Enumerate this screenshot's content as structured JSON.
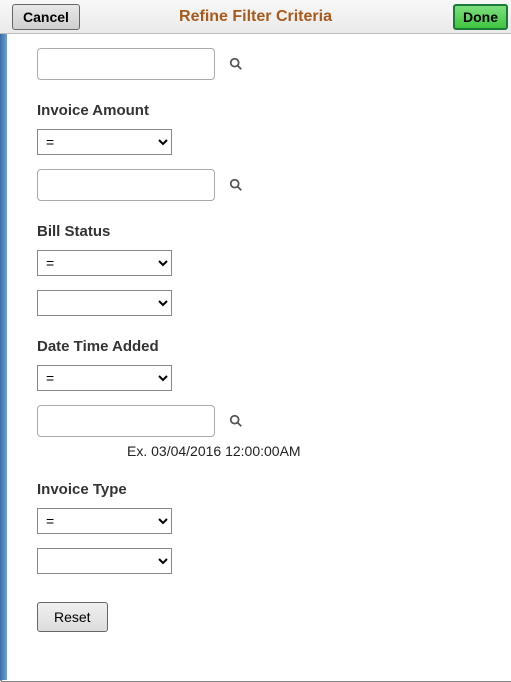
{
  "header": {
    "title": "Refine Filter Criteria",
    "cancel_label": "Cancel",
    "done_label": "Done"
  },
  "fields": {
    "top_lookup": {
      "value": ""
    },
    "invoice_amount": {
      "label": "Invoice Amount",
      "operator": "=",
      "value": ""
    },
    "bill_status": {
      "label": "Bill Status",
      "operator": "=",
      "value": ""
    },
    "date_time_added": {
      "label": "Date Time Added",
      "operator": "=",
      "value": "",
      "example": "Ex. 03/04/2016 12:00:00AM"
    },
    "invoice_type": {
      "label": "Invoice Type",
      "operator": "=",
      "value": ""
    }
  },
  "buttons": {
    "reset_label": "Reset"
  }
}
